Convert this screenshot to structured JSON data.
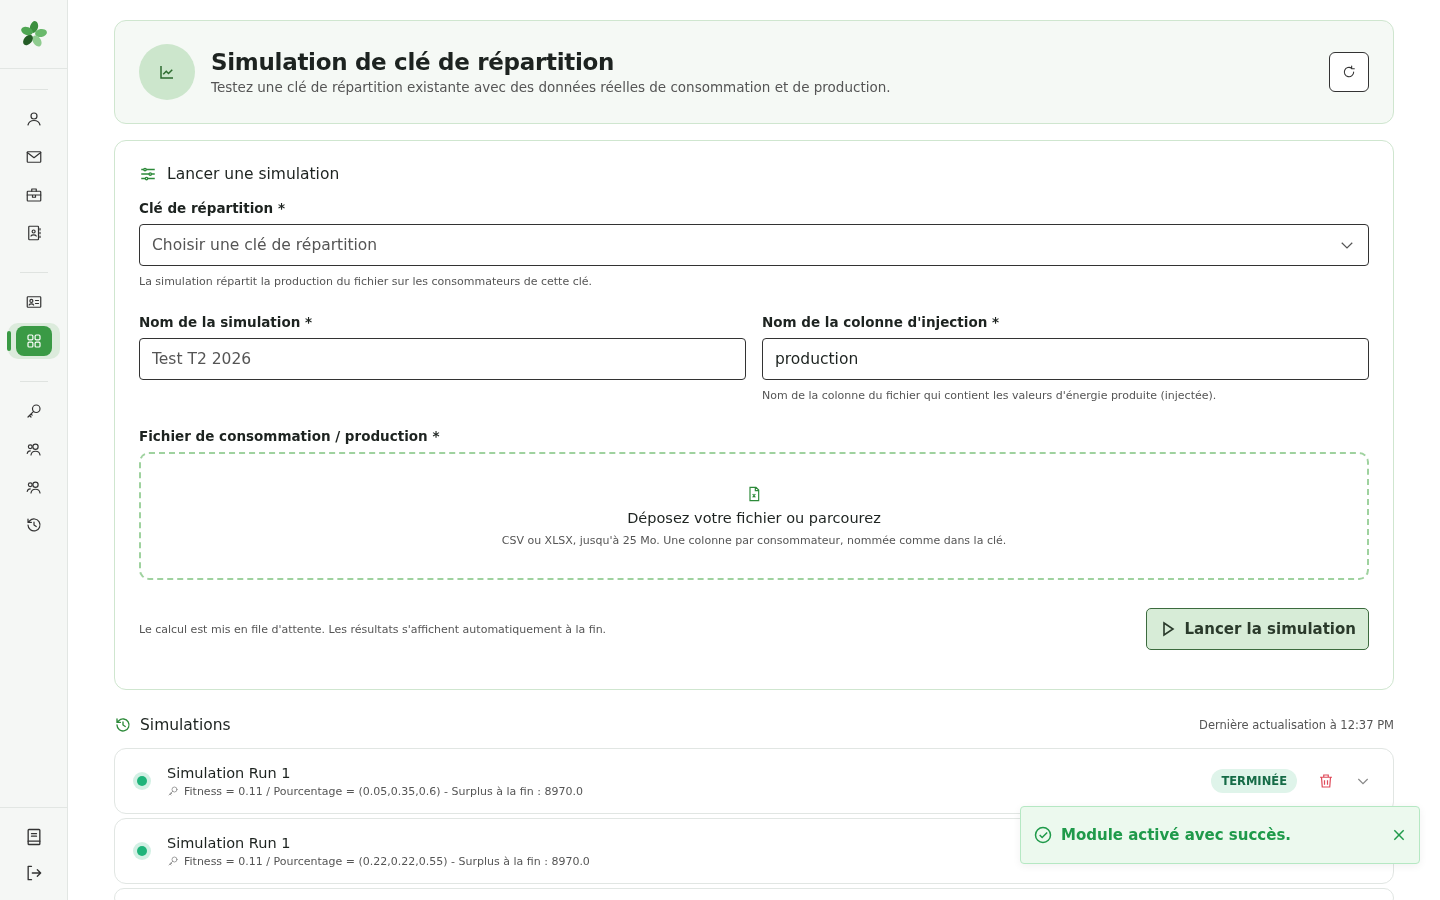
{
  "sidebar": {
    "groups": [
      [
        {
          "kind": "user",
          "selected": false
        },
        {
          "kind": "mail",
          "selected": false
        },
        {
          "kind": "briefcase",
          "selected": false
        },
        {
          "kind": "contacts",
          "selected": false
        }
      ],
      [
        {
          "kind": "idcard",
          "selected": false
        },
        {
          "kind": "grid",
          "selected": true
        }
      ],
      [
        {
          "kind": "key",
          "selected": false
        },
        {
          "kind": "users",
          "selected": false
        },
        {
          "kind": "users",
          "selected": false
        },
        {
          "kind": "history",
          "selected": false
        }
      ]
    ],
    "bottom": [
      {
        "kind": "book"
      },
      {
        "kind": "logout"
      }
    ]
  },
  "header": {
    "title": "Simulation de clé de répartition",
    "subtitle": "Testez une clé de répartition existante avec des données réelles de consommation et de production."
  },
  "form": {
    "title": "Lancer une simulation",
    "key_field": {
      "label": "Clé de répartition *",
      "placeholder": "Choisir une clé de répartition",
      "help": "La simulation répartit la production du fichier sur les consommateurs de cette clé."
    },
    "name_field": {
      "label": "Nom de la simulation *",
      "placeholder": "Test T2 2026"
    },
    "column_field": {
      "label": "Nom de la colonne d'injection *",
      "value": "production",
      "help": "Nom de la colonne du fichier qui contient les valeurs d'énergie produite (injectée)."
    },
    "file_field": {
      "label": "Fichier de consommation / production *",
      "title": "Déposez votre fichier ou parcourez",
      "hint": "CSV ou XLSX, jusqu'à 25 Mo. Une colonne par consommateur, nommée comme dans la clé."
    },
    "note": "Le calcul est mis en file d'attente. Les résultats s'affichent automatiquement à la fin.",
    "submit": "Lancer la simulation"
  },
  "simulations": {
    "title": "Simulations",
    "updated": "Dernière actualisation à 12:37 PM",
    "runs": [
      {
        "name": "Simulation Run 1",
        "details": "Fitness = 0.11 / Pourcentage = (0.05,0.35,0.6) - Surplus à la fin : 8970.0",
        "status": "TERMINÉE",
        "color": "#1fb47a"
      },
      {
        "name": "Simulation Run 1",
        "details": "Fitness = 0.11 / Pourcentage = (0.22,0.22,0.55) - Surplus à la fin : 8970.0",
        "color": "#1fb47a"
      }
    ]
  },
  "toast": {
    "message": "Module activé avec succès."
  }
}
